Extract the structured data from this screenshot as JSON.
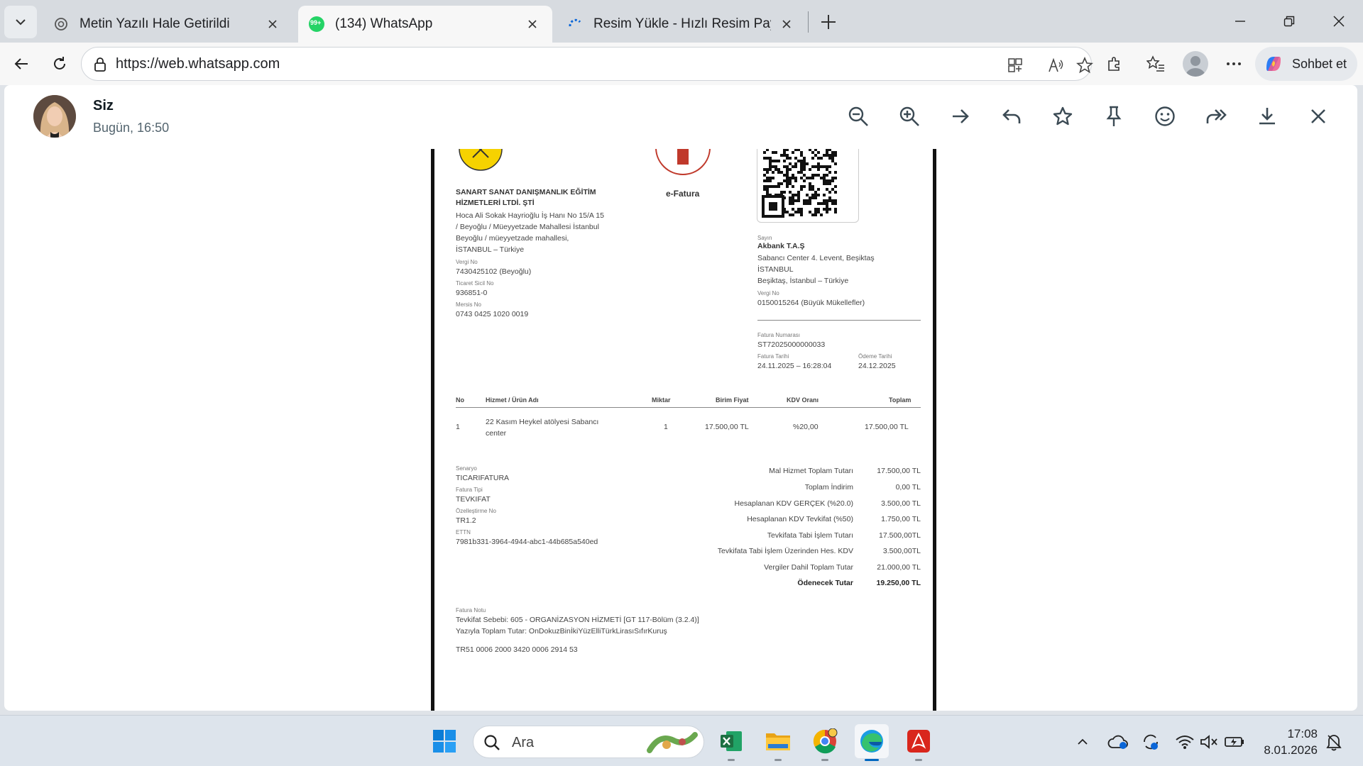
{
  "browser": {
    "tabs": [
      {
        "title": "Metin Yazılı Hale Getirildi",
        "icon": "chatgpt-icon"
      },
      {
        "title": "(134) WhatsApp",
        "icon": "whatsapp-icon",
        "badge": "99+"
      },
      {
        "title": "Resim Yükle - Hızlı Resim Paylaş - İ",
        "icon": "loading-icon"
      }
    ],
    "url": "https://web.whatsapp.com",
    "copilot_label": "Sohbet et"
  },
  "viewer": {
    "sender": "Siz",
    "time": "Bugün, 16:50"
  },
  "invoice": {
    "seller": {
      "name_line1": "SANART SANAT DANIŞMANLIK EĞİTİM",
      "name_line2": "HİZMETLERİ LTDİ. ŞTİ",
      "addr1": "Hoca Ali Sokak Hayrioğlu İş Hanı No 15/A 15",
      "addr2": "/ Beyoğlu / Müeyyetzade Mahallesi İstanbul",
      "addr3": "Beyoğlu / müeyyetzade mahallesi,",
      "addr4": "İSTANBUL – Türkiye",
      "vergi_label": "Vergi No",
      "vergi": "7430425102 (Beyoğlu)",
      "ticaret_label": "Ticaret Sicil No",
      "ticaret": "936851-0",
      "mersis_label": "Mersis No",
      "mersis": "0743 0425 1020 0019"
    },
    "efatura": "e-Fatura",
    "buyer": {
      "label": "Sayın",
      "name": "Akbank T.A.Ş",
      "addr1": "Sabancı Center 4. Levent, Beşiktaş",
      "addr2": "İSTANBUL",
      "addr3": "Beşiktaş, İstanbul – Türkiye",
      "vergi_label": "Vergi No",
      "vergi": "0150015264 (Büyük Mükellefler)"
    },
    "fatura_no_label": "Fatura Numarası",
    "fatura_no": "ST72025000000033",
    "fatura_tarihi_label": "Fatura Tarihi",
    "fatura_tarihi": "24.11.2025 – 16:28:04",
    "odeme_tarihi_label": "Ödeme Tarihi",
    "odeme_tarihi": "24.12.2025",
    "table": {
      "headers": {
        "no": "No",
        "urun": "Hizmet / Ürün Adı",
        "miktar": "Miktar",
        "birim": "Birim Fiyat",
        "kdv": "KDV Oranı",
        "toplam": "Toplam"
      },
      "row": {
        "no": "1",
        "urun1": "22 Kasım Heykel atölyesi Sabancı",
        "urun2": "center",
        "miktar": "1",
        "birim": "17.500,00 TL",
        "kdv": "%20,00",
        "toplam": "17.500,00 TL"
      }
    },
    "meta": {
      "senaryo_label": "Senaryo",
      "senaryo": "TICARIFATURA",
      "tip_label": "Fatura Tipi",
      "tip": "TEVKIFAT",
      "ozel_label": "Özelleştirme No",
      "ozel": "TR1.2",
      "ettn_label": "ETTN",
      "ettn": "7981b331-3964-4944-abc1-44b685a540ed"
    },
    "summary": [
      {
        "label": "Mal Hizmet Toplam Tutarı",
        "value": "17.500,00 TL"
      },
      {
        "label": "Toplam İndirim",
        "value": "0,00 TL"
      },
      {
        "label": "Hesaplanan KDV GERÇEK (%20.0)",
        "value": "3.500,00 TL"
      },
      {
        "label": "Hesaplanan KDV Tevkifat (%50)",
        "value": "1.750,00 TL"
      },
      {
        "label": "Tevkifata Tabi İşlem Tutarı",
        "value": "17.500,00TL"
      },
      {
        "label": "Tevkifata Tabi İşlem Üzerinden Hes. KDV",
        "value": "3.500,00TL"
      },
      {
        "label": "Vergiler Dahil Toplam Tutar",
        "value": "21.000,00 TL"
      },
      {
        "label": "Ödenecek Tutar",
        "value": "19.250,00 TL"
      }
    ],
    "notes": {
      "label": "Fatura Notu",
      "line1": "Tevkifat Sebebi: 605 - ORGANİZASYON HİZMETİ [GT 117-Bölüm (3.2.4)]",
      "line2": "Yazıyla Toplam Tutar: OnDokuzBinİkiYüzElliTürkLirasıSıfırKuruş",
      "iban": "TR51 0006 2000 3420 0006 2914 53"
    }
  },
  "taskbar": {
    "search_placeholder": "Ara",
    "time": "17:08",
    "date": "8.01.2026"
  },
  "colors": {
    "accent": "#0067c0",
    "whatsapp": "#25d366",
    "adobe": "#d9261c",
    "excel": "#1d6f42"
  }
}
